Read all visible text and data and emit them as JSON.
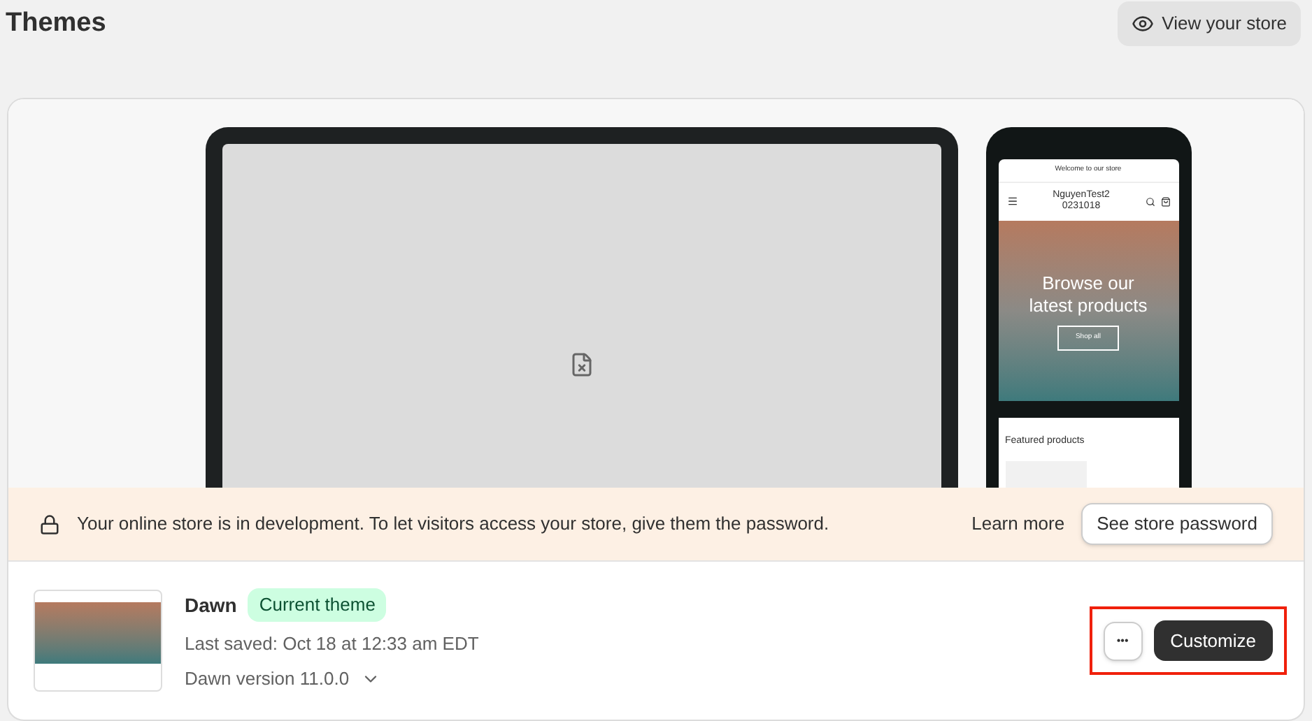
{
  "page": {
    "title": "Themes",
    "view_store": "View your store"
  },
  "phone_preview": {
    "announcement": "Welcome to our store",
    "store_name": "NguyenTest2 0231018",
    "hero_title": "Browse our latest products",
    "hero_button": "Shop all",
    "section_title": "Featured products"
  },
  "banner": {
    "message": "Your online store is in development. To let visitors access your store, give them the password.",
    "link": "Learn more",
    "button": "See store password"
  },
  "theme": {
    "name": "Dawn",
    "badge": "Current theme",
    "last_saved": "Last saved: Oct 18 at 12:33 am EDT",
    "version": "Dawn version 11.0.0",
    "more_button": "•••",
    "customize_button": "Customize",
    "highlighted": true
  }
}
